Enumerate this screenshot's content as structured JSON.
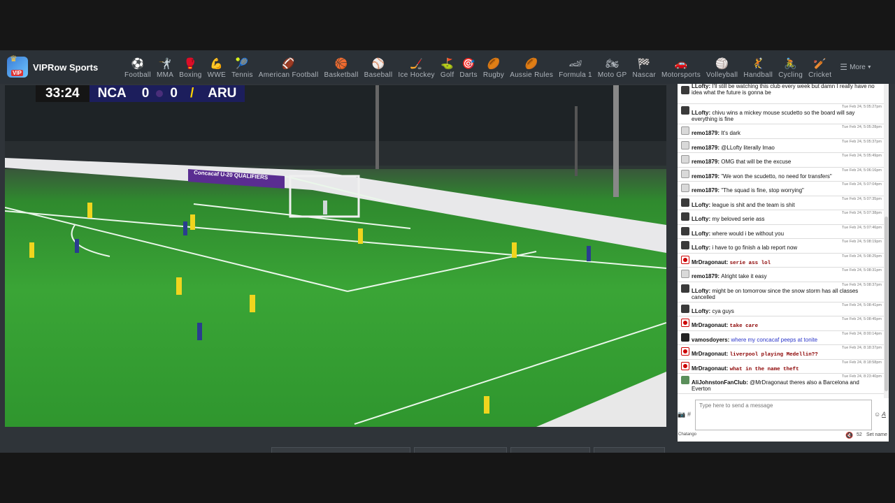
{
  "brand": {
    "name": "VIPRow Sports",
    "logo_text": "VIP"
  },
  "nav": [
    {
      "label": "Football",
      "icon": "⚽"
    },
    {
      "label": "MMA",
      "icon": "🤺"
    },
    {
      "label": "Boxing",
      "icon": "🥊"
    },
    {
      "label": "WWE",
      "icon": "💪"
    },
    {
      "label": "Tennis",
      "icon": "🎾"
    },
    {
      "label": "American Football",
      "icon": "🏈"
    },
    {
      "label": "Basketball",
      "icon": "🏀"
    },
    {
      "label": "Baseball",
      "icon": "⚾"
    },
    {
      "label": "Ice Hockey",
      "icon": "🏒"
    },
    {
      "label": "Golf",
      "icon": "⛳"
    },
    {
      "label": "Darts",
      "icon": "🎯"
    },
    {
      "label": "Rugby",
      "icon": "🏉"
    },
    {
      "label": "Aussie Rules",
      "icon": "🏉"
    },
    {
      "label": "Formula 1",
      "icon": "🏎"
    },
    {
      "label": "Moto GP",
      "icon": "🏍"
    },
    {
      "label": "Nascar",
      "icon": "🏁"
    },
    {
      "label": "Motorsports",
      "icon": "🚗"
    },
    {
      "label": "Volleyball",
      "icon": "🏐"
    },
    {
      "label": "Handball",
      "icon": "🤾"
    },
    {
      "label": "Cycling",
      "icon": "🚴"
    },
    {
      "label": "Cricket",
      "icon": "🏏"
    }
  ],
  "more_label": "More",
  "scorebug": {
    "clock": "33:24",
    "home": "NCA",
    "home_score": "0",
    "away_score": "0",
    "away": "ARU",
    "separator": "/"
  },
  "video_banner": "Concacaf U-20 QUALIFIERS",
  "chat": {
    "messages": [
      {
        "time": "",
        "user": "LLofty",
        "text": "I'll still be watching this club every week but damn I really have no idea what the future is gonna be",
        "avatar": "lofty",
        "style": "normal",
        "tall": true
      },
      {
        "time": "Tue Feb 24, 5:05:27pm",
        "user": "LLofty",
        "text": "chivu wins a mickey mouse scudetto so the board will say everything is fine",
        "avatar": "lofty",
        "style": "normal",
        "tall": true
      },
      {
        "time": "Tue Feb 24, 5:05:28pm",
        "user": "remo1879",
        "text": "It's dark",
        "avatar": "remo",
        "style": "normal"
      },
      {
        "time": "Tue Feb 24, 5:05:37pm",
        "user": "remo1879",
        "text": "@LLofty literally lmao",
        "avatar": "remo",
        "style": "normal"
      },
      {
        "time": "Tue Feb 24, 5:05:49pm",
        "user": "remo1879",
        "text": "OMG that will be the excuse",
        "avatar": "remo",
        "style": "normal"
      },
      {
        "time": "Tue Feb 24, 5:06:16pm",
        "user": "remo1879",
        "text": "\"We won the scudetto, no need for transfers\"",
        "avatar": "remo",
        "style": "normal"
      },
      {
        "time": "Tue Feb 24, 5:07:04pm",
        "user": "remo1879",
        "text": "\"The squad is fine, stop worrying\"",
        "avatar": "remo",
        "style": "normal"
      },
      {
        "time": "Tue Feb 24, 5:07:35pm",
        "user": "LLofty",
        "text": "league is shit and the team is shit",
        "avatar": "lofty",
        "style": "normal"
      },
      {
        "time": "Tue Feb 24, 5:07:38pm",
        "user": "LLofty",
        "text": "my beloved serie ass",
        "avatar": "lofty",
        "style": "normal"
      },
      {
        "time": "Tue Feb 24, 5:07:46pm",
        "user": "LLofty",
        "text": "where would i be without you",
        "avatar": "lofty",
        "style": "normal"
      },
      {
        "time": "Tue Feb 24, 5:08:19pm",
        "user": "LLofty",
        "text": "i have to go finish a lab report now",
        "avatar": "lofty",
        "style": "normal"
      },
      {
        "time": "Tue Feb 24, 5:08:25pm",
        "user": "MrDragonaut",
        "text": "serie ass lol",
        "avatar": "drag",
        "style": "mono"
      },
      {
        "time": "Tue Feb 24, 5:08:31pm",
        "user": "remo1879",
        "text": "Alright take it easy",
        "avatar": "remo",
        "style": "normal"
      },
      {
        "time": "Tue Feb 24, 5:08:37pm",
        "user": "LLofty",
        "text": "might be on tomorrow since the snow storm has all classes cancelled",
        "avatar": "lofty",
        "style": "normal",
        "tall": true
      },
      {
        "time": "Tue Feb 24, 5:08:41pm",
        "user": "LLofty",
        "text": "cya guys",
        "avatar": "lofty",
        "style": "normal"
      },
      {
        "time": "Tue Feb 24, 5:08:45pm",
        "user": "MrDragonaut",
        "text": "take care",
        "avatar": "drag",
        "style": "mono"
      },
      {
        "time": "Tue Feb 24, 8:00:14pm",
        "user": "vamosdoyers",
        "text": "where my concacaf peeps at tonite",
        "avatar": "vamos",
        "style": "blue"
      },
      {
        "time": "Tue Feb 24, 8:18:37pm",
        "user": "MrDragonaut",
        "text": "liverpool playing Medellin??",
        "avatar": "drag",
        "style": "mono"
      },
      {
        "time": "Tue Feb 24, 8:18:58pm",
        "user": "MrDragonaut",
        "text": "what in the name theft",
        "avatar": "drag",
        "style": "mono"
      },
      {
        "time": "Tue Feb 24, 8:23:40pm",
        "user": "AliJohnstonFanClub",
        "text": "@MrDragonaut theres also a Barcelona and Everton",
        "avatar": "ali",
        "style": "normal",
        "tall": true
      }
    ],
    "input_placeholder": "Type here to send a message",
    "footer_brand": "Chatango",
    "viewer_count": "52",
    "set_name_label": "Set name"
  }
}
